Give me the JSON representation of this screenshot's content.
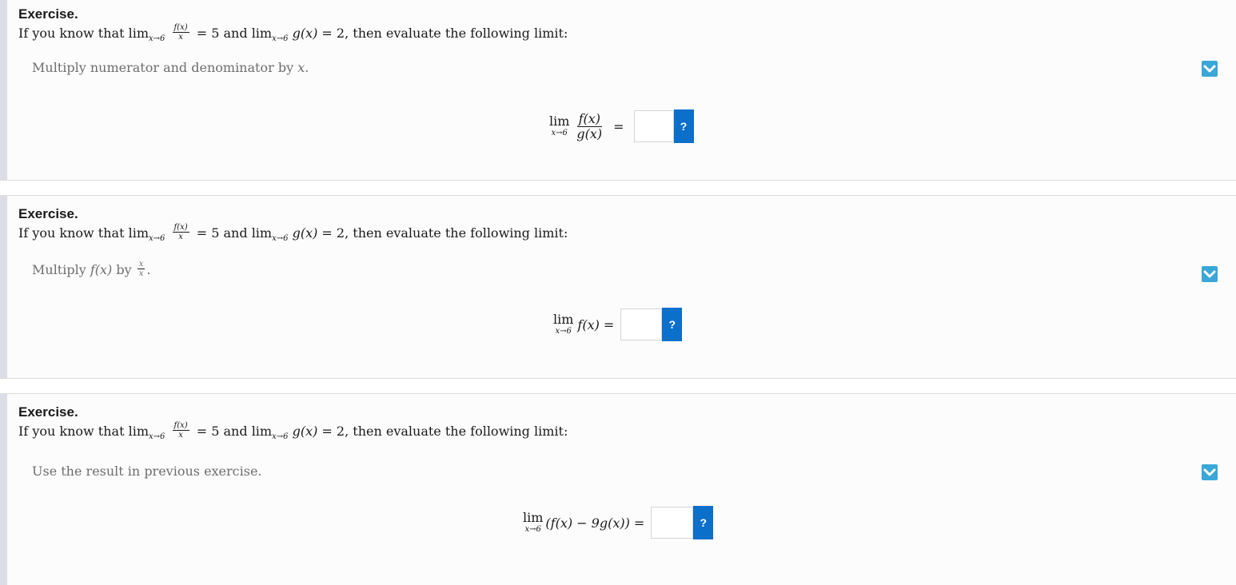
{
  "exercises": [
    {
      "title": "Exercise.",
      "problem": {
        "intro": "If you know that",
        "lim1": "lim",
        "lim1_sub": "x→6",
        "frac_num": "f(x)",
        "frac_den": "x",
        "eq1": "= 5 and",
        "lim2": "lim",
        "lim2_sub": "x→6",
        "g_expr": "g(x)",
        "rest": "= 2, then evaluate the following limit:"
      },
      "hint": "Multiply numerator and denominator by ",
      "hint_var": "x",
      "hint_end": ".",
      "expression": {
        "lim": "lim",
        "lim_sub": "x→6",
        "num": "f(x)",
        "den": "g(x)",
        "eq": "="
      },
      "input_value": "",
      "help_label": "?"
    },
    {
      "title": "Exercise.",
      "problem": {
        "intro": "If you know that",
        "lim1": "lim",
        "lim1_sub": "x→6",
        "frac_num": "f(x)",
        "frac_den": "x",
        "eq1": "= 5 and",
        "lim2": "lim",
        "lim2_sub": "x→6",
        "g_expr": "g(x)",
        "rest": "= 2, then evaluate the following limit:"
      },
      "hint": "Multiply ",
      "hint_var": "f(x)",
      "hint_mid": " by ",
      "hint_frac_num": "x",
      "hint_frac_den": "x",
      "hint_end": ".",
      "expression": {
        "lim": "lim",
        "lim_sub": "x→6",
        "body": "f(x)",
        "eq": "="
      },
      "input_value": "",
      "help_label": "?"
    },
    {
      "title": "Exercise.",
      "problem": {
        "intro": "If you know that",
        "lim1": "lim",
        "lim1_sub": "x→6",
        "frac_num": "f(x)",
        "frac_den": "x",
        "eq1": "= 5 and",
        "lim2": "lim",
        "lim2_sub": "x→6",
        "g_expr": "g(x)",
        "rest": "= 2, then evaluate the following limit:"
      },
      "hint": "Use the result in previous exercise.",
      "expression": {
        "lim": "lim",
        "lim_sub": "x→6",
        "body": "(f(x) − 9g(x))",
        "eq": "="
      },
      "input_value": "",
      "help_label": "?"
    }
  ],
  "icons": {
    "toggle": "chevron-down-icon"
  },
  "colors": {
    "toggle_bg": "#3aa7d8",
    "help_bg": "#0c6fc9",
    "left_bar": "#dcdde7"
  }
}
